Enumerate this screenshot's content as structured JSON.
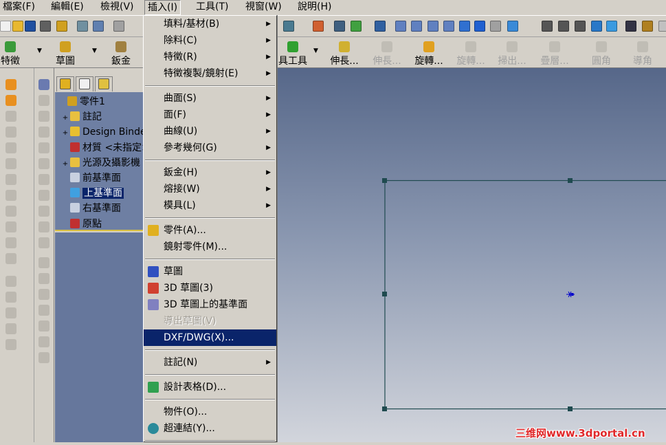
{
  "menubar": {
    "items": [
      "檔案(F)",
      "編輯(E)",
      "檢視(V)",
      "插入(I)",
      "工具(T)",
      "視窗(W)",
      "說明(H)"
    ],
    "open": "插入(I)"
  },
  "toolbar": {
    "icons": [
      "new-icon",
      "open-icon",
      "save-icon",
      "print-preview-icon",
      "rebuild-icon",
      "print-icon",
      "preview-icon",
      "undo-icon",
      "equation-icon",
      "display-icon",
      "measure-icon",
      "properties-icon",
      "select-icon",
      "zoom-to-fit-icon",
      "zoom-area-icon",
      "zoom-in-out-icon",
      "zoom-selection-icon",
      "rotate-icon",
      "pan-icon",
      "view-orient-icon",
      "standard-views-icon",
      "wireframe-icon",
      "hidden-lines-visible-icon",
      "hidden-lines-removed-icon",
      "shaded-edges-icon",
      "shaded-icon",
      "shadows-icon",
      "section-view-icon",
      "realview-icon"
    ]
  },
  "command_manager": {
    "buttons": [
      {
        "label": "特徵",
        "enabled": true
      },
      {
        "label": "草圖",
        "enabled": true
      },
      {
        "label": "鈑金",
        "enabled": true
      },
      {
        "label": "具工具",
        "enabled": true
      },
      {
        "label": "伸長...",
        "enabled": true
      },
      {
        "label": "伸長...",
        "enabled": false
      },
      {
        "label": "旋轉...",
        "enabled": true
      },
      {
        "label": "旋轉...",
        "enabled": false
      },
      {
        "label": "掃出...",
        "enabled": false
      },
      {
        "label": "疊層...",
        "enabled": false
      },
      {
        "label": "圓角",
        "enabled": false
      },
      {
        "label": "導角",
        "enabled": false
      }
    ]
  },
  "feature_tree": {
    "tabs": [
      "feature-manager-tab",
      "property-manager-tab",
      "configuration-manager-tab"
    ],
    "nodes": [
      {
        "label": "零件1",
        "expander": ""
      },
      {
        "label": "註記",
        "expander": "+"
      },
      {
        "label": "Design Binder",
        "expander": "+"
      },
      {
        "label": "材質 <未指定>",
        "expander": ""
      },
      {
        "label": "光源及攝影機",
        "expander": "+"
      },
      {
        "label": "前基準面",
        "expander": ""
      },
      {
        "label": "上基準面",
        "expander": "",
        "selected": true
      },
      {
        "label": "右基準面",
        "expander": ""
      },
      {
        "label": "原點",
        "expander": ""
      }
    ]
  },
  "insert_menu": {
    "groups": [
      [
        {
          "label": "填料/基材(B)",
          "submenu": true
        },
        {
          "label": "除料(C)",
          "submenu": true
        },
        {
          "label": "特徵(R)",
          "submenu": true
        },
        {
          "label": "特徵複製/鏡射(E)",
          "submenu": true
        }
      ],
      [
        {
          "label": "曲面(S)",
          "submenu": true
        },
        {
          "label": "面(F)",
          "submenu": true
        },
        {
          "label": "曲線(U)",
          "submenu": true
        },
        {
          "label": "參考幾何(G)",
          "submenu": true
        }
      ],
      [
        {
          "label": "鈑金(H)",
          "submenu": true
        },
        {
          "label": "熔接(W)",
          "submenu": true
        },
        {
          "label": "模具(L)",
          "submenu": true
        }
      ],
      [
        {
          "label": "零件(A)...",
          "icon": "part-icon"
        },
        {
          "label": "鏡射零件(M)..."
        }
      ],
      [
        {
          "label": "草圖",
          "icon": "sketch-icon"
        },
        {
          "label": "3D 草圖(3)",
          "icon": "3d-sketch-icon"
        },
        {
          "label": "3D 草圖上的基準面",
          "icon": "3d-sketch-plane-icon"
        },
        {
          "label": "導出草圖(V)",
          "disabled": true
        },
        {
          "label": "DXF/DWG(X)...",
          "highlighted": true
        }
      ],
      [
        {
          "label": "註記(N)",
          "submenu": true
        }
      ],
      [
        {
          "label": "設計表格(D)...",
          "icon": "design-table-icon"
        }
      ],
      [
        {
          "label": "物件(O)..."
        },
        {
          "label": "超連結(Y)...",
          "icon": "hyperlink-icon"
        }
      ]
    ]
  },
  "watermark": "三维网www.3dportal.cn",
  "colors": {
    "highlight": "#0a246a",
    "sketch_line": "#1f4a4f",
    "origin": "#0000cc",
    "watermark": "#e0282a"
  }
}
